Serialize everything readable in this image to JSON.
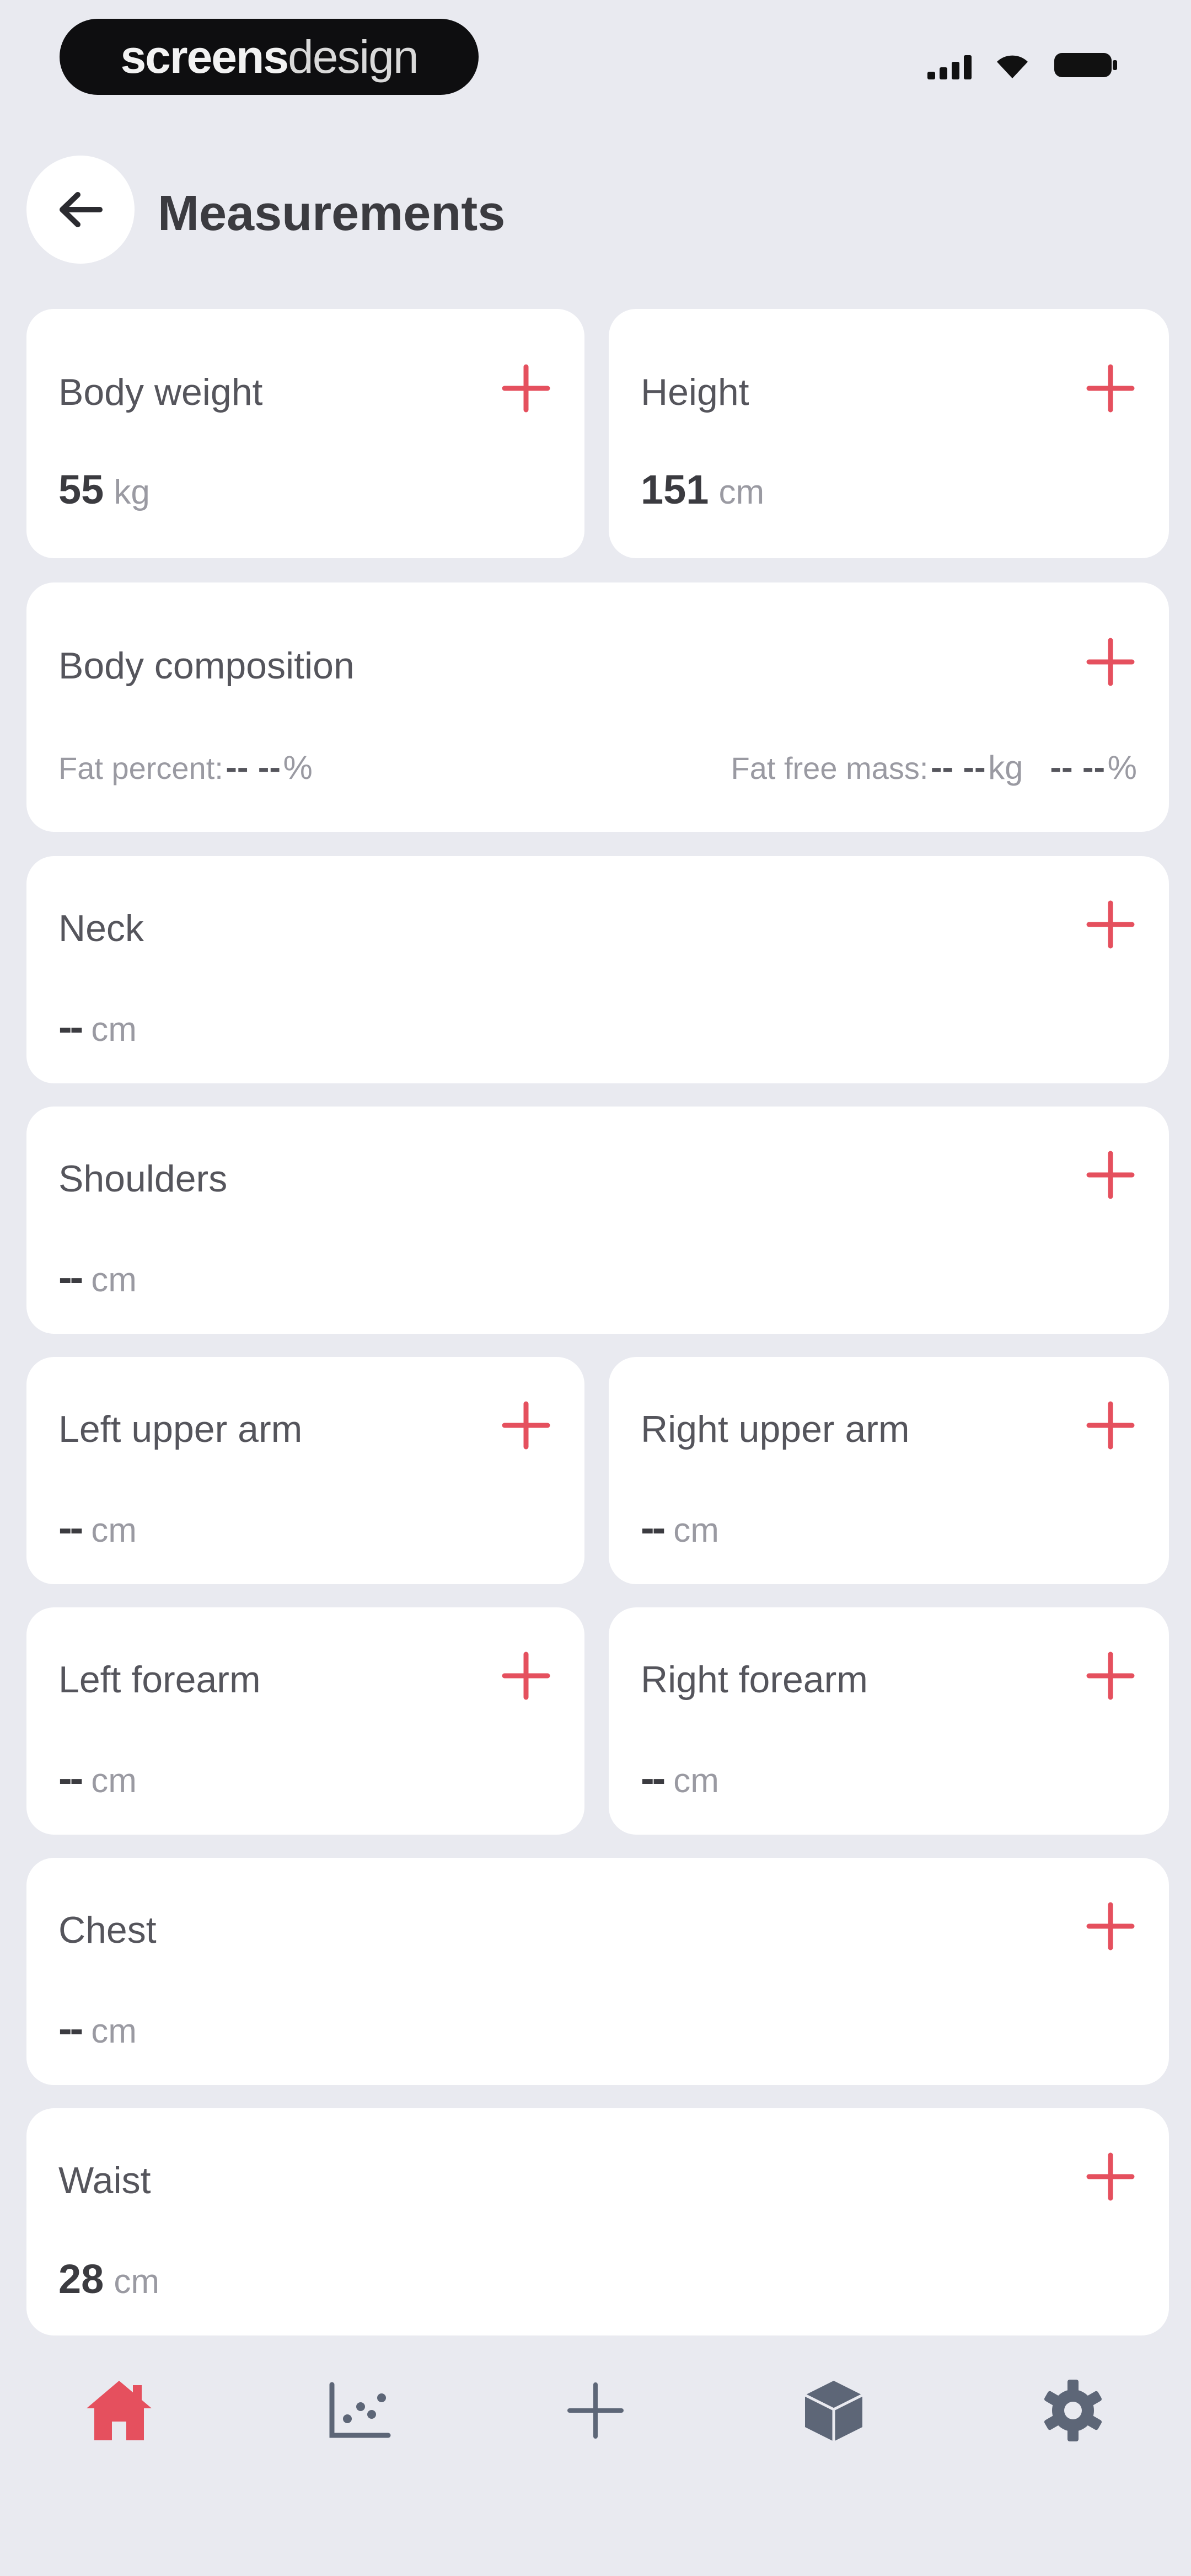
{
  "status_bar": {
    "brand_bold": "screens",
    "brand_light": "design"
  },
  "header": {
    "title": "Measurements"
  },
  "cards": {
    "body_weight": {
      "label": "Body weight",
      "value": "55",
      "unit": "kg"
    },
    "height": {
      "label": "Height",
      "value": "151",
      "unit": "cm"
    },
    "body_composition": {
      "label": "Body composition",
      "fat_percent_label": "Fat percent:",
      "fat_percent_value": "-- --",
      "fat_percent_unit": "%",
      "fat_free_label": "Fat free mass:",
      "fat_free_value": "-- --",
      "fat_free_unit": "kg",
      "fat_free_pct_value": "-- --",
      "fat_free_pct_unit": "%"
    },
    "neck": {
      "label": "Neck",
      "value": "--",
      "unit": "cm"
    },
    "shoulders": {
      "label": "Shoulders",
      "value": "--",
      "unit": "cm"
    },
    "left_upper_arm": {
      "label": "Left upper arm",
      "value": "--",
      "unit": "cm"
    },
    "right_upper_arm": {
      "label": "Right upper arm",
      "value": "--",
      "unit": "cm"
    },
    "left_forearm": {
      "label": "Left forearm",
      "value": "--",
      "unit": "cm"
    },
    "right_forearm": {
      "label": "Right forearm",
      "value": "--",
      "unit": "cm"
    },
    "chest": {
      "label": "Chest",
      "value": "--",
      "unit": "cm"
    },
    "waist": {
      "label": "Waist",
      "value": "28",
      "unit": "cm"
    }
  },
  "nav": {
    "items": [
      "home-icon",
      "chart-icon",
      "plus-icon",
      "cube-icon",
      "gear-icon"
    ],
    "active": "home-icon"
  },
  "colors": {
    "accent": "#e5505e",
    "background": "#e9eaf0",
    "card": "#ffffff",
    "nav_icon": "#5d6677"
  }
}
